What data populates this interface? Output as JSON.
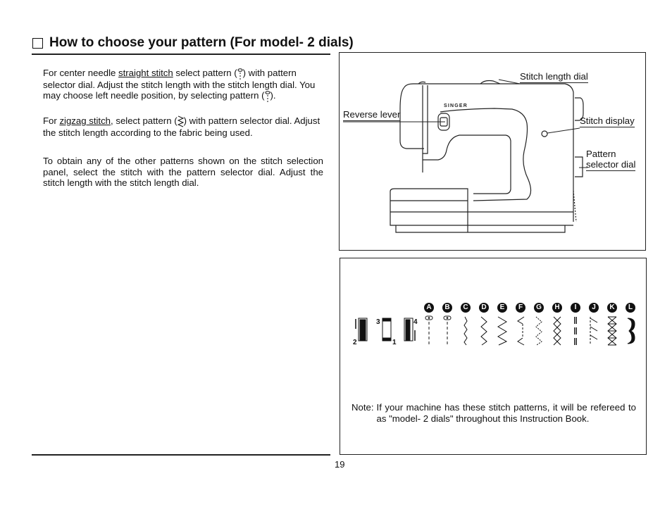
{
  "section": {
    "title": "How to choose your pattern (For model- 2 dials)"
  },
  "instructions": {
    "p1": {
      "before": "For center needle ",
      "link": "straight stitch",
      "after": " select pattern (",
      "after2": ") with pattern selector dial. Adjust the stitch length with the stitch length dial. You may choose left needle position, by selecting pattern (",
      "after3": ")."
    },
    "p2": {
      "before": "For ",
      "link": "zigzag stitch",
      "after": ", select pattern (",
      "after2": ") with pattern selector dial. Adjust the stitch length according to the fabric being used."
    },
    "p3": "To obtain any of the other patterns shown on the stitch selection panel, select the stitch with the pattern selector dial. Adjust the stitch length with the stitch length dial."
  },
  "machine_diagram": {
    "brand": "SINGER",
    "labels": {
      "stitch_length_dial": "Stitch length dial",
      "reverse_lever": "Reverse lever",
      "stitch_display": "Stitch display",
      "pattern_selector_line1": "Pattern",
      "pattern_selector_line2": "selector dial"
    }
  },
  "stitch_panel": {
    "needle_positions": [
      "1",
      "2",
      "3",
      "1",
      "4"
    ],
    "patterns": [
      {
        "letter": "A",
        "icon": "straight-stitch-center-icon"
      },
      {
        "letter": "B",
        "icon": "straight-stitch-left-icon"
      },
      {
        "letter": "C",
        "icon": "narrow-zigzag-icon"
      },
      {
        "letter": "D",
        "icon": "medium-zigzag-icon"
      },
      {
        "letter": "E",
        "icon": "wide-zigzag-icon"
      },
      {
        "letter": "F",
        "icon": "blind-hem-icon"
      },
      {
        "letter": "G",
        "icon": "multi-step-zigzag-icon"
      },
      {
        "letter": "H",
        "icon": "honeycomb-stitch-icon"
      },
      {
        "letter": "I",
        "icon": "triple-straight-icon"
      },
      {
        "letter": "J",
        "icon": "stretch-blind-hem-icon"
      },
      {
        "letter": "K",
        "icon": "overlock-stitch-icon"
      },
      {
        "letter": "L",
        "icon": "buttonhole-scallop-icon"
      }
    ],
    "note_label": "Note:",
    "note_text": "If your machine has these stitch patterns, it will be refereed to as \"model- 2 dials\" throughout this Instruction Book."
  },
  "footer": {
    "page_number": "19"
  }
}
